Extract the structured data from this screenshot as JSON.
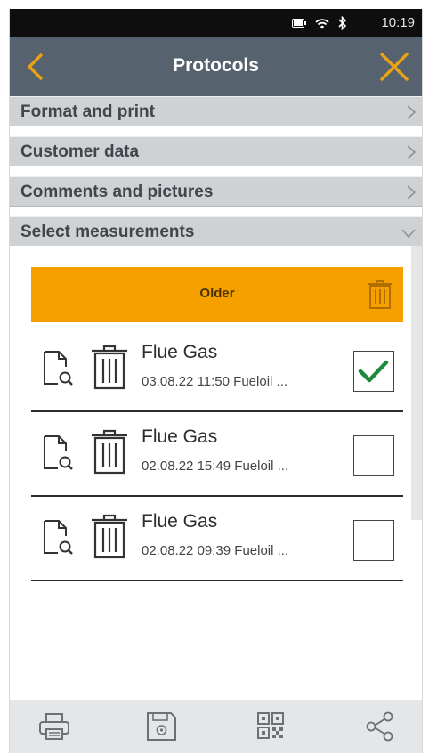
{
  "status_bar": {
    "time": "10:19",
    "icons": [
      "battery-icon",
      "wifi-icon",
      "bluetooth-icon"
    ]
  },
  "header": {
    "title": "Protocols",
    "back_icon": "chevron-left-icon",
    "close_icon": "close-icon",
    "accent_color": "#e8a317"
  },
  "sections": [
    {
      "label": "Format and print",
      "state": "collapsed"
    },
    {
      "label": "Customer data",
      "state": "collapsed"
    },
    {
      "label": "Comments and pictures",
      "state": "collapsed"
    },
    {
      "label": "Select measurements",
      "state": "expanded"
    }
  ],
  "older_group": {
    "label": "Older",
    "color": "#f6a000"
  },
  "measurements": [
    {
      "title": "Flue Gas",
      "date": "03.08.22",
      "time": "11:50",
      "fuel": "Fueloil ...",
      "checked": true
    },
    {
      "title": "Flue Gas",
      "date": "02.08.22",
      "time": "15:49",
      "fuel": "Fueloil ...",
      "checked": false
    },
    {
      "title": "Flue Gas",
      "date": "02.08.22",
      "time": "09:39",
      "fuel": "Fueloil ...",
      "checked": false
    }
  ],
  "bottom_bar": {
    "icons": [
      "printer-icon",
      "save-icon",
      "qr-code-icon",
      "share-icon"
    ]
  }
}
